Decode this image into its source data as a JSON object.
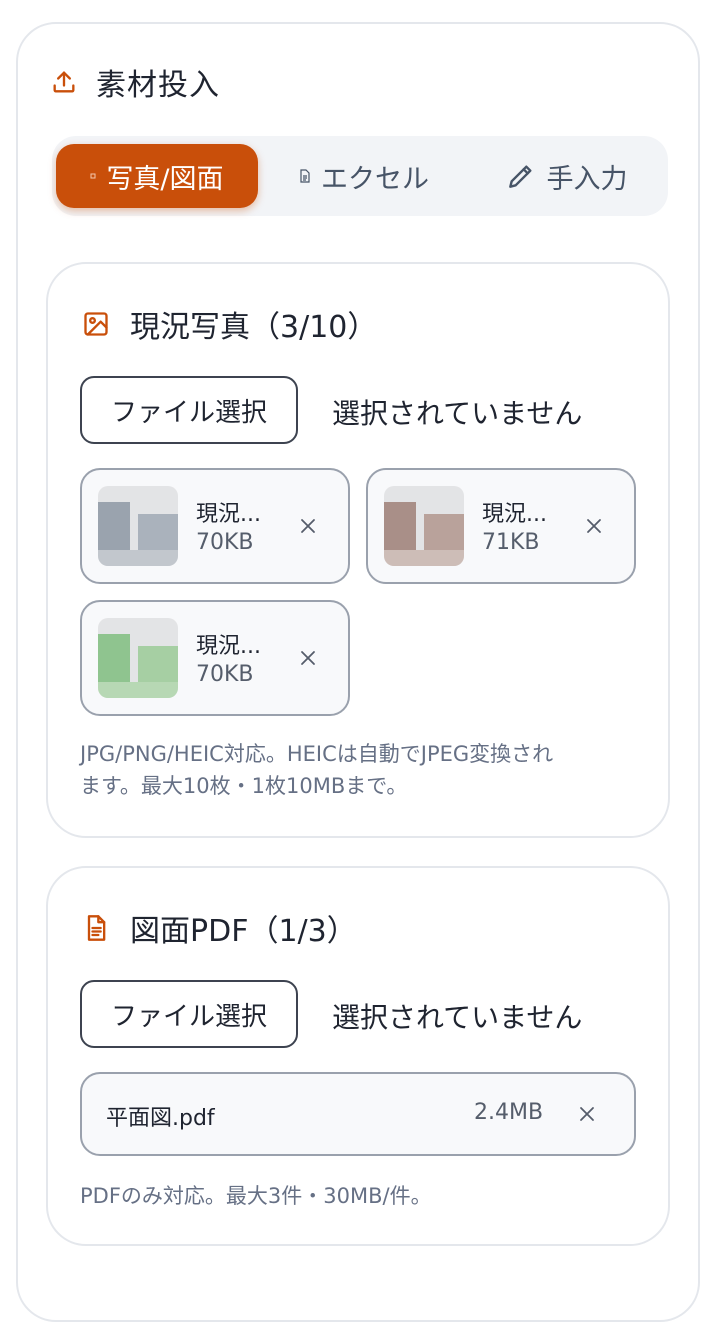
{
  "panel": {
    "title": "素材投入",
    "accent": "#c94f0a"
  },
  "tabs": [
    {
      "label": "写真/図面",
      "active": true
    },
    {
      "label": "エクセル",
      "active": false
    },
    {
      "label": "手入力",
      "active": false
    }
  ],
  "photos": {
    "title": "現況写真（3/10）",
    "file_button": "ファイル選択",
    "no_file": "選択されていません",
    "files": [
      {
        "name": "現況...",
        "size": "70KB"
      },
      {
        "name": "現況...",
        "size": "71KB"
      },
      {
        "name": "現況...",
        "size": "70KB"
      }
    ],
    "hint_line1": "JPG/PNG/HEIC対応。HEICは自動でJPEG変換され",
    "hint_line2": "ます。最大10枚・1枚10MBまで。"
  },
  "drawings": {
    "title": "図面PDF（1/3）",
    "file_button": "ファイル選択",
    "no_file": "選択されていません",
    "files": [
      {
        "name": "平面図.pdf",
        "size": "2.4MB"
      }
    ],
    "hint": "PDFのみ対応。最大3件・30MB/件。"
  }
}
